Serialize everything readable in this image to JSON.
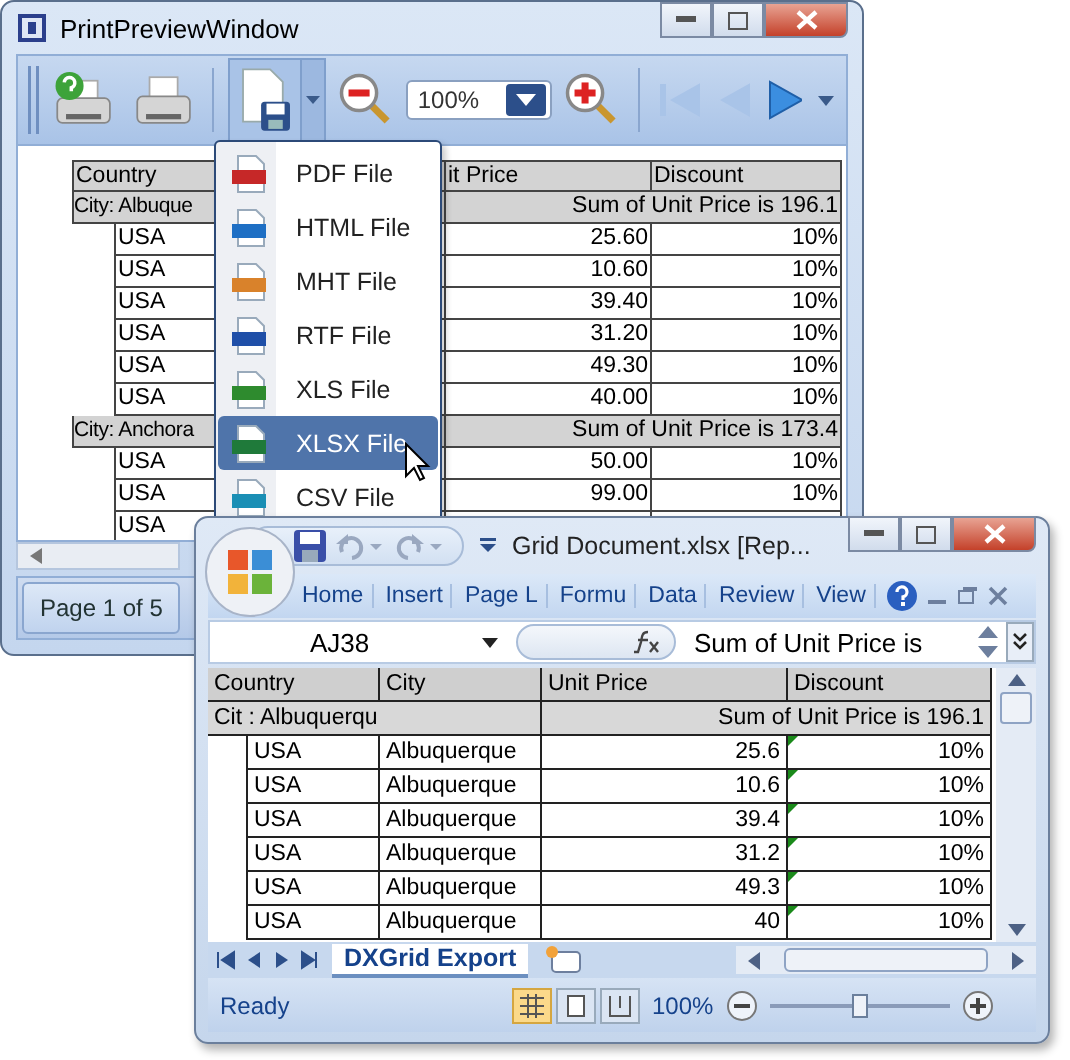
{
  "preview_window": {
    "title": "PrintPreviewWindow",
    "zoom": "100%",
    "table": {
      "columns": [
        "Country",
        "it Price",
        "Discount"
      ],
      "groups": [
        {
          "label": "City: Albuque",
          "summary": "Sum of Unit Price is 196.1",
          "rows": [
            {
              "country": "USA",
              "price": "25.60",
              "discount": "10%"
            },
            {
              "country": "USA",
              "price": "10.60",
              "discount": "10%"
            },
            {
              "country": "USA",
              "price": "39.40",
              "discount": "10%"
            },
            {
              "country": "USA",
              "price": "31.20",
              "discount": "10%"
            },
            {
              "country": "USA",
              "price": "49.30",
              "discount": "10%"
            },
            {
              "country": "USA",
              "price": "40.00",
              "discount": "10%"
            }
          ]
        },
        {
          "label": "City: Anchora",
          "summary": "Sum of Unit Price is 173.4",
          "rows": [
            {
              "country": "USA",
              "price": "50.00",
              "discount": "10%"
            },
            {
              "country": "USA",
              "price": "99.00",
              "discount": "10%"
            },
            {
              "country": "USA"
            }
          ]
        }
      ]
    },
    "status": "Page 1 of 5"
  },
  "export_menu": {
    "items": [
      {
        "label": "PDF File",
        "color": "#c62828",
        "selected": false
      },
      {
        "label": "HTML File",
        "color": "#1e6fc4",
        "selected": false
      },
      {
        "label": "MHT File",
        "color": "#d9822b",
        "selected": false
      },
      {
        "label": "RTF File",
        "color": "#1f4fa8",
        "selected": false
      },
      {
        "label": "XLS File",
        "color": "#2e8b2e",
        "selected": false
      },
      {
        "label": "XLSX File",
        "color": "#1f7a3a",
        "selected": true
      },
      {
        "label": "CSV File",
        "color": "#1a8fb5",
        "selected": false
      }
    ]
  },
  "excel_window": {
    "title": "Grid Document.xlsx [Rep...",
    "ribbon_tabs": [
      "Home",
      "Insert",
      "Page L",
      "Formu",
      "Data",
      "Review",
      "View"
    ],
    "name_box": "AJ38",
    "formula": "Sum of Unit Price is",
    "columns": [
      "Country",
      "City",
      "Unit Price",
      "Discount"
    ],
    "group": {
      "label": "Cit : Albuquerqu",
      "summary": "Sum of Unit Price is 196.1"
    },
    "rows": [
      {
        "country": "USA",
        "city": "Albuquerque",
        "price": "25.6",
        "discount": "10%"
      },
      {
        "country": "USA",
        "city": "Albuquerque",
        "price": "10.6",
        "discount": "10%"
      },
      {
        "country": "USA",
        "city": "Albuquerque",
        "price": "39.4",
        "discount": "10%"
      },
      {
        "country": "USA",
        "city": "Albuquerque",
        "price": "31.2",
        "discount": "10%"
      },
      {
        "country": "USA",
        "city": "Albuquerque",
        "price": "49.3",
        "discount": "10%"
      },
      {
        "country": "USA",
        "city": "Albuquerque",
        "price": "40",
        "discount": "10%"
      }
    ],
    "sheet_tab": "DXGrid Export",
    "status": "Ready",
    "zoom": "100%",
    "zoom_slider": {
      "level": 0.5
    }
  }
}
